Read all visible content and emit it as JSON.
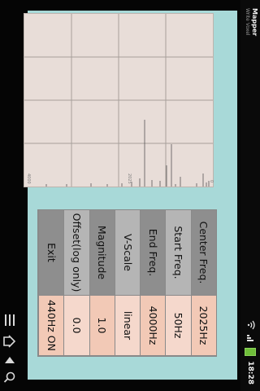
{
  "statusbar": {
    "app_title": "Mapper",
    "subtitle": "Write Voxel"
  },
  "plot": {
    "x_tick_labels": [
      "0",
      "2025",
      "4000"
    ]
  },
  "settings": {
    "rows": [
      {
        "label": "Center Freq.",
        "value": "2025Hz"
      },
      {
        "label": "Start Freq.",
        "value": "50Hz"
      },
      {
        "label": "End Freq.",
        "value": "4000Hz"
      },
      {
        "label": "V-Scale",
        "value": "linear"
      },
      {
        "label": "Magnitude",
        "value": "1.0"
      },
      {
        "label": "Offset(log only)",
        "value": "0.0"
      },
      {
        "label": "Exit",
        "value": "440Hz ON"
      }
    ]
  },
  "status": {
    "time": "18:28"
  },
  "colors": {
    "app_background": "#a8d9d8",
    "label_cell": "#8e8e8e",
    "value_cell": "#f2c9b6"
  }
}
